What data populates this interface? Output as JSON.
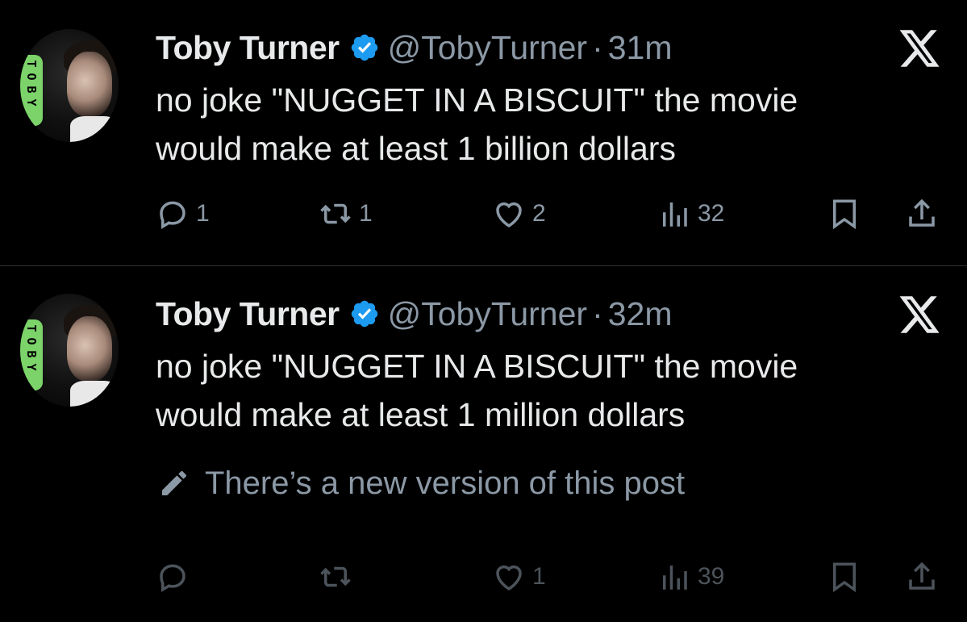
{
  "colors": {
    "background": "#000000",
    "text": "#e7e9ea",
    "muted": "#8b98a5",
    "verified": "#1d9bf0",
    "avatar_badge": "#7bd36a"
  },
  "tweets": [
    {
      "avatar_badge_letters": [
        "T",
        "O",
        "B",
        "Y"
      ],
      "name": "Toby Turner",
      "handle": "@TobyTurner",
      "separator": "·",
      "time": "31m",
      "text_line1": "no joke \"NUGGET IN A BISCUIT\" the movie",
      "text_line2": "would make at least 1 billion dollars",
      "replies": "1",
      "reposts": "1",
      "likes": "2",
      "views": "32",
      "icons": [
        "reply-icon",
        "repost-icon",
        "like-icon",
        "views-icon",
        "bookmark-icon",
        "share-icon"
      ]
    },
    {
      "avatar_badge_letters": [
        "T",
        "O",
        "B",
        "Y"
      ],
      "name": "Toby Turner",
      "handle": "@TobyTurner",
      "separator": "·",
      "time": "32m",
      "text_line1": "no joke \"NUGGET IN A BISCUIT\" the movie",
      "text_line2": "would make at least 1 million dollars",
      "edit_notice": "There’s a new version of this post",
      "replies": "",
      "reposts": "",
      "likes": "1",
      "views": "39",
      "icons": [
        "reply-icon",
        "repost-icon",
        "like-icon",
        "views-icon",
        "bookmark-icon",
        "share-icon"
      ]
    }
  ]
}
